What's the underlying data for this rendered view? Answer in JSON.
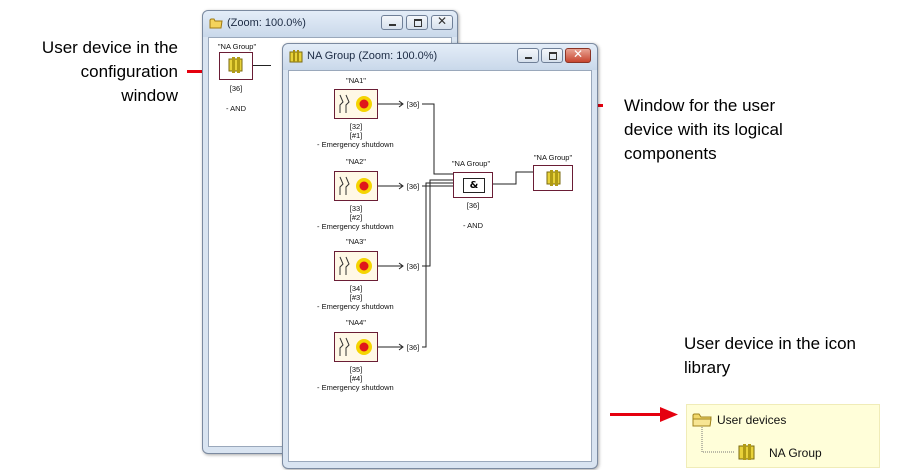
{
  "callouts": {
    "config_window": [
      "User device in the",
      "configuration",
      "window"
    ],
    "logic_window": [
      "Window for the user",
      "device with its logical",
      "components"
    ],
    "icon_library": [
      "User device in the icon",
      "library"
    ]
  },
  "back_window": {
    "title": "(Zoom: 100.0%)",
    "device_label": "\"NA Group\"",
    "device_id": "[36]",
    "device_desc": "- AND",
    "buttons": {
      "minimize": "minimize",
      "maximize": "maximize",
      "close": "✕"
    }
  },
  "front_window": {
    "title": "NA Group (Zoom: 100.0%)",
    "buttons": {
      "minimize": "minimize",
      "maximize": "maximize",
      "close": "✕"
    },
    "sensors": [
      {
        "label": "\"NA1\"",
        "id": "[32]",
        "num": "[#1]",
        "desc": "- Emergency shutdown",
        "out": "[36]"
      },
      {
        "label": "\"NA2\"",
        "id": "[33]",
        "num": "[#2]",
        "desc": "- Emergency shutdown",
        "out": "[36]"
      },
      {
        "label": "\"NA3\"",
        "id": "[34]",
        "num": "[#3]",
        "desc": "- Emergency shutdown",
        "out": "[36]"
      },
      {
        "label": "\"NA4\"",
        "id": "[35]",
        "num": "[#4]",
        "desc": "- Emergency shutdown",
        "out": "[36]"
      }
    ],
    "and_gate": {
      "label": "\"NA Group\"",
      "symbol": "&",
      "id": "[36]",
      "desc": "- AND"
    },
    "output_device": {
      "label": "\"NA Group\""
    }
  },
  "icon_library": {
    "folder_label": "User devices",
    "item_label": "NA Group"
  },
  "colors": {
    "callout_line": "#e5000f",
    "device_border": "#6a1d35",
    "library_bg": "#fffed9"
  }
}
